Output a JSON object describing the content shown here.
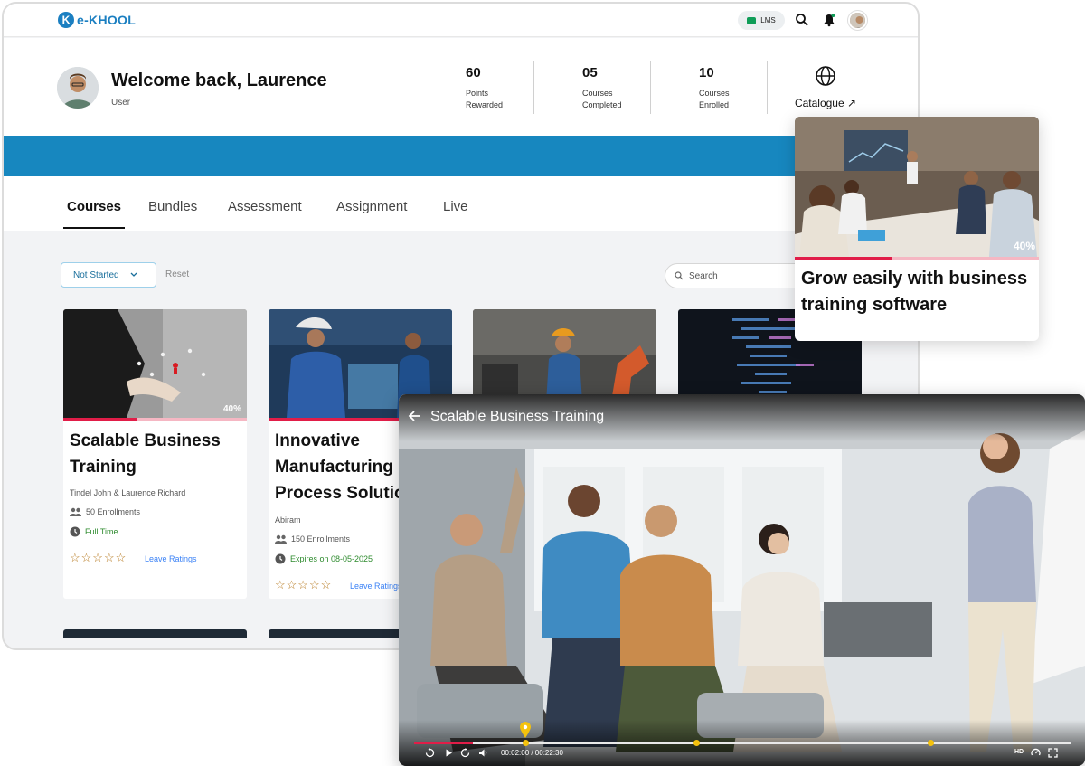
{
  "app": {
    "logo_letter": "K",
    "logo_text": "e-KHOOL",
    "lms_label": "LMS"
  },
  "welcome": {
    "title": "Welcome back, Laurence",
    "role": "User"
  },
  "stats": [
    {
      "value": "60",
      "label": "Points Rewarded"
    },
    {
      "value": "05",
      "label": "Courses Completed"
    },
    {
      "value": "10",
      "label": "Courses Enrolled"
    }
  ],
  "catalogue": {
    "label": "Catalogue ↗"
  },
  "tabs": [
    {
      "label": "Courses"
    },
    {
      "label": "Bundles"
    },
    {
      "label": "Assessment"
    },
    {
      "label": "Assignment"
    },
    {
      "label": "Live"
    }
  ],
  "filters": {
    "status": "Not Started",
    "reset": "Reset",
    "search_placeholder": "Search"
  },
  "courses": [
    {
      "title": "Scalable Business Training",
      "progress_pct": 40,
      "progress_label": "40%",
      "authors": "Tindel John & Laurence Richard",
      "enrollments": "50 Enrollments",
      "status": "Full Time",
      "stars": "☆☆☆☆☆",
      "rating_link": "Leave Ratings"
    },
    {
      "title": "Innovative Manufacturing Process Solutions",
      "progress_pct": 100,
      "authors": "Abiram",
      "enrollments": "150 Enrollments",
      "status": "Expires on 08-05-2025",
      "stars": "☆☆☆☆☆",
      "rating_link": "Leave Ratings"
    }
  ],
  "featured": {
    "title": "Grow easily with business training software",
    "progress_pct": 40,
    "progress_label": "40%"
  },
  "player": {
    "title": "Scalable Business Training",
    "time": "00:02:00 / 00:22:30",
    "played_fraction": 0.09,
    "hd_label": "HD"
  },
  "colors": {
    "brand": "#1b7fc1",
    "band": "#1787bf",
    "progress": "#e11d48",
    "marker": "#f4c20d"
  }
}
